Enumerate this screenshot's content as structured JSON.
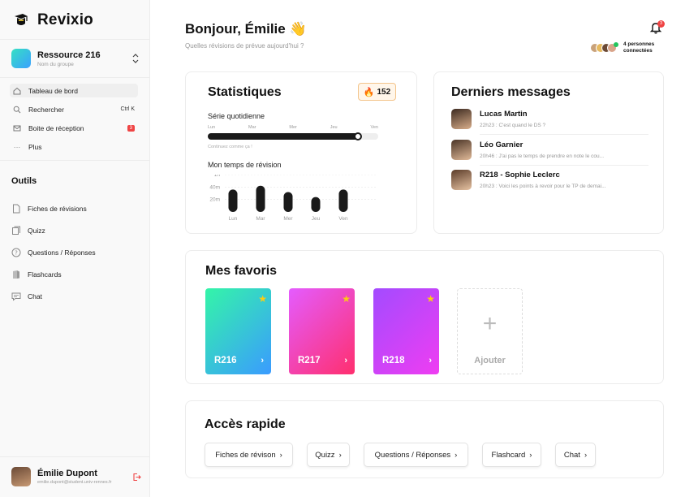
{
  "app": {
    "name": "Revixio"
  },
  "group": {
    "name": "Ressource 216",
    "subtitle": "Nom du groupe"
  },
  "nav": [
    {
      "label": "Tableau de bord",
      "icon": "home-icon",
      "active": true
    },
    {
      "label": "Rechercher",
      "icon": "search-icon",
      "shortcut": "Ctrl K"
    },
    {
      "label": "Boite de réception",
      "icon": "mail-icon",
      "badge": "3"
    },
    {
      "label": "Plus",
      "icon": "more-icon"
    }
  ],
  "tools": {
    "title": "Outils",
    "items": [
      {
        "label": "Fiches de révisions",
        "icon": "document-icon"
      },
      {
        "label": "Quizz",
        "icon": "quiz-icon"
      },
      {
        "label": "Questions / Réponses",
        "icon": "question-icon"
      },
      {
        "label": "Flashcards",
        "icon": "flashcards-icon"
      },
      {
        "label": "Chat",
        "icon": "chat-icon"
      }
    ]
  },
  "user": {
    "name": "Émilie Dupont",
    "email": "emilie.dupont@student.univ-rennes.fr"
  },
  "header": {
    "greeting": "Bonjour, Émilie 👋",
    "subtitle": "Quelles révisions de prévue aujourd'hui ?",
    "notification_count": "3",
    "online_text": "4 personnes connectées"
  },
  "stats": {
    "title": "Statistiques",
    "streak": "152",
    "daily_label": "Série quotidienne",
    "days": [
      "Lun",
      "Mar",
      "Mer",
      "Jeu",
      "Ven"
    ],
    "progress": 0.88,
    "hint": "Continuez comme ça !",
    "time_label": "Mon temps de révision"
  },
  "chart_data": {
    "type": "bar",
    "categories": [
      "Lun",
      "Mar",
      "Mer",
      "Jeu",
      "Ven"
    ],
    "values": [
      36,
      42,
      32,
      24,
      36
    ],
    "yticks": [
      "1h",
      "40m",
      "20m"
    ],
    "ytick_values": [
      60,
      40,
      20
    ],
    "ylim": [
      0,
      60
    ],
    "title": "",
    "xlabel": "",
    "ylabel": ""
  },
  "messages": {
    "title": "Derniers messages",
    "items": [
      {
        "name": "Lucas Martin",
        "preview": "22h23 : C'est quand le DS ?"
      },
      {
        "name": "Léo Garnier",
        "preview": "20h46 : J'ai pas le temps de prendre en note le cou..."
      },
      {
        "name": "R218 - Sophie Leclerc",
        "preview": "20h23 : Voici les points à revoir pour le TP de demai..."
      }
    ]
  },
  "favorites": {
    "title": "Mes favoris",
    "items": [
      {
        "name": "R216",
        "colors": [
          "#34f5a8",
          "#3a9bff"
        ]
      },
      {
        "name": "R217",
        "colors": [
          "#e45cff",
          "#ff2f6e"
        ]
      },
      {
        "name": "R218",
        "colors": [
          "#a34bff",
          "#ef3df2"
        ]
      }
    ],
    "add_label": "Ajouter"
  },
  "quick": {
    "title": "Accès rapide",
    "items": [
      "Fiches de révison",
      "Quizz",
      "Questions / Réponses",
      "Flashcard",
      "Chat"
    ]
  },
  "colors": {
    "accent": "#1a1a1a",
    "danger": "#ef4444",
    "streak": "#f97316",
    "star": "#facc15"
  }
}
